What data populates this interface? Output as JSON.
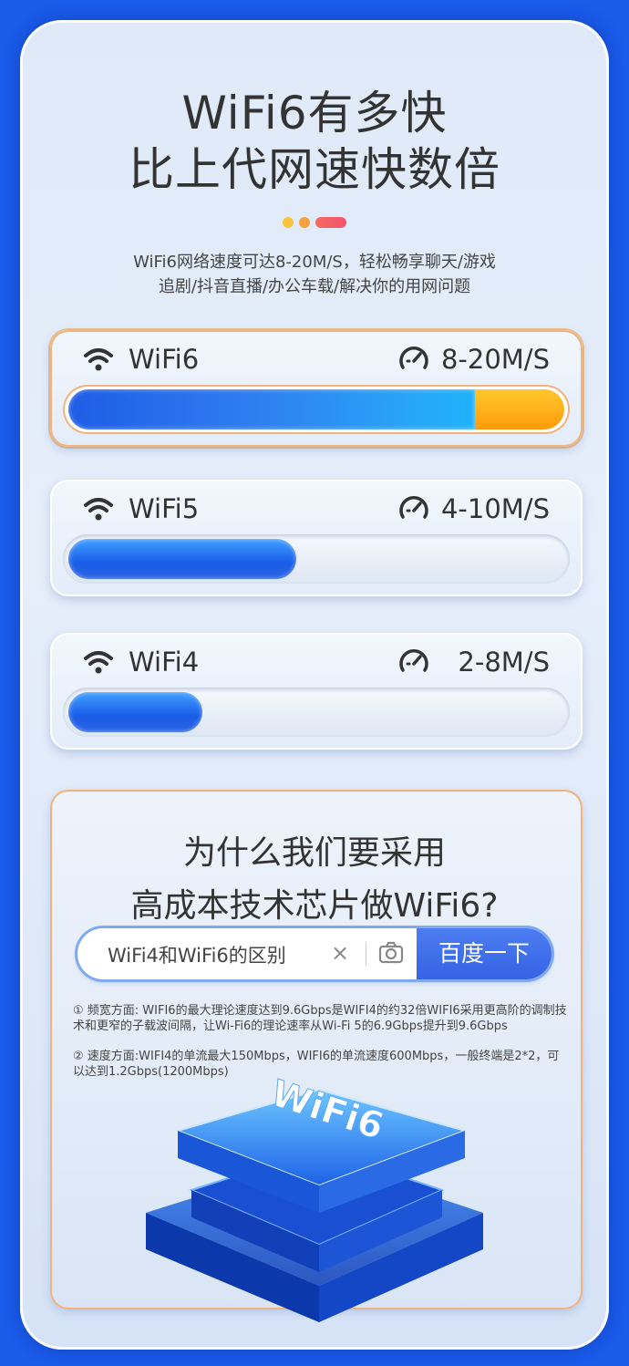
{
  "headline": {
    "line1": "WiFi6有多快",
    "line2": "比上代网速快数倍"
  },
  "subtitle": {
    "line1": "WiFi6网络速度可达8-20M/S，轻松畅享聊天/游戏",
    "line2": "追剧/抖音直播/办公车载/解决你的用网问题"
  },
  "speeds": [
    {
      "label": "WiFi6",
      "value": "8-20M/S",
      "fill": 0.82,
      "highlight": true
    },
    {
      "label": "WiFi5",
      "value": "4-10M/S",
      "fill": 0.46,
      "highlight": false
    },
    {
      "label": "WiFi4",
      "value": "2-8M/S",
      "fill": 0.27,
      "highlight": false
    }
  ],
  "why": {
    "line1": "为什么我们要采用",
    "line2": "高成本技术芯片做WiFi6?"
  },
  "search": {
    "query": "WiFi4和WiFi6的区别",
    "clear": "×",
    "button": "百度一下"
  },
  "notes": [
    "① 频宽方面: WIFI6的最大理论速度达到9.6Gbps是WIFI4的约32倍WIFI6采用更高阶的调制技术和更窄的子载波间隔，让Wi-Fi6的理论速率从Wi-Fi 5的6.9Gbps提升到9.6Gbps",
    "② 速度方面:WIFI4的单流最大150Mbps，WIFI6的单流速度600Mbps，一般终端是2*2，可以达到1.2Gbps(1200Mbps)"
  ],
  "chip_logo": "WiFi6",
  "colors": {
    "background": "#1a5bea",
    "bar_blue": "#1a5ce8",
    "bar_orange": "#ff9b0a",
    "accent_border": "#f1b27c"
  }
}
